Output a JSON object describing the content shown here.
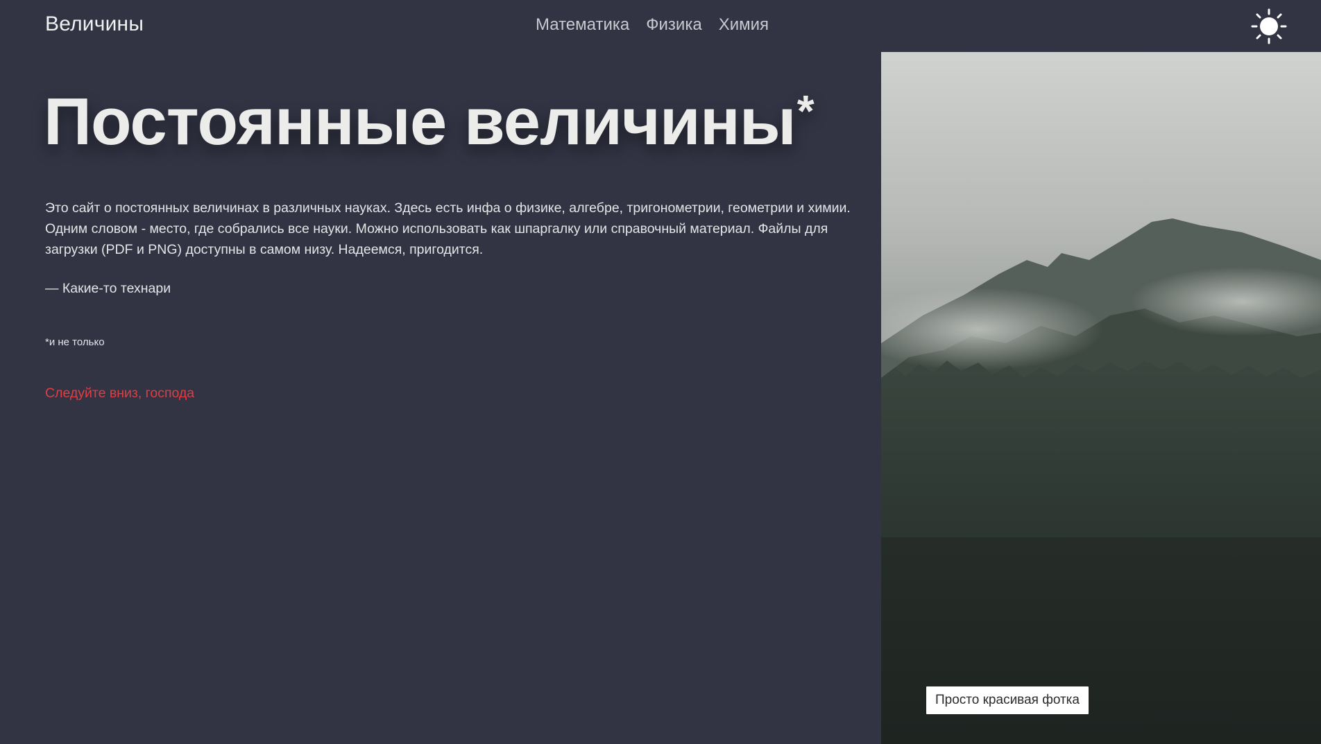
{
  "header": {
    "site_title": "Величины",
    "nav": [
      {
        "label": "Математика"
      },
      {
        "label": "Физика"
      },
      {
        "label": "Химия"
      }
    ],
    "theme_toggle_icon": "sun-icon"
  },
  "hero": {
    "title": "Постоянные величины",
    "title_mark": "*",
    "intro": "Это сайт о постоянных величинах в различных науках. Здесь есть инфа о физике, алгебре, тригонометрии, геометрии и химии. Одним словом - место, где собрались все науки. Можно использовать как шпаргалку или справочный материал. Файлы для загрузки (PDF и PNG) доступны в самом низу. Надеемся, пригодится.",
    "signature": "— Какие-то технари",
    "footnote": "*и не только",
    "scroll_link": "Следуйте вниз, господа"
  },
  "photo": {
    "caption": "Просто красивая фотка"
  },
  "colors": {
    "background": "#323444",
    "accent_link": "#e23d43",
    "text": "#e9e9ea"
  }
}
